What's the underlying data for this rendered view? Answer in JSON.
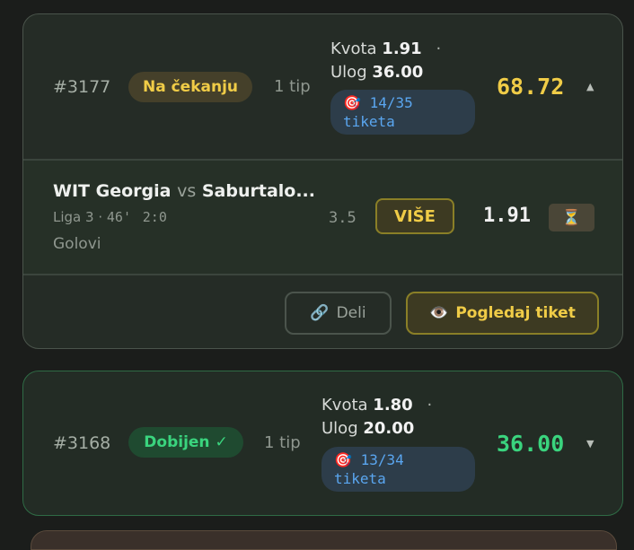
{
  "tickets": [
    {
      "id": "#3177",
      "status": "Na čekanju",
      "tips": "1 tip",
      "kvota_label": "Kvota",
      "kvota": "1.91",
      "ulog_label": "Ulog",
      "ulog": "36.00",
      "separator": "·",
      "progress_icon": "🎯",
      "progress_count": "14/35",
      "progress_label": "tiketa",
      "payout": "68.72",
      "payout_color": "#f0cc47",
      "expanded": true,
      "arrow": "▲",
      "selection": {
        "home": "WIT Georgia",
        "vs": "vs",
        "away": "Saburtalo...",
        "league": "Liga 3",
        "minute": "46'",
        "score": "2:0",
        "market": "Golovi",
        "line": "3.5",
        "pick": "VIŠE",
        "odd": "1.91",
        "state_icon": "⏳"
      },
      "actions": {
        "share_icon": "🔗",
        "share_label": "Deli",
        "view_icon": "👁️",
        "view_label": "Pogledaj tiket"
      }
    },
    {
      "id": "#3168",
      "status": "Dobijen ✓",
      "tips": "1 tip",
      "kvota_label": "Kvota",
      "kvota": "1.80",
      "ulog_label": "Ulog",
      "ulog": "20.00",
      "separator": "·",
      "progress_icon": "🎯",
      "progress_count": "13/34",
      "progress_label": "tiketa",
      "payout": "36.00",
      "payout_color": "#3ad47e",
      "expanded": false,
      "arrow": "▼"
    }
  ]
}
